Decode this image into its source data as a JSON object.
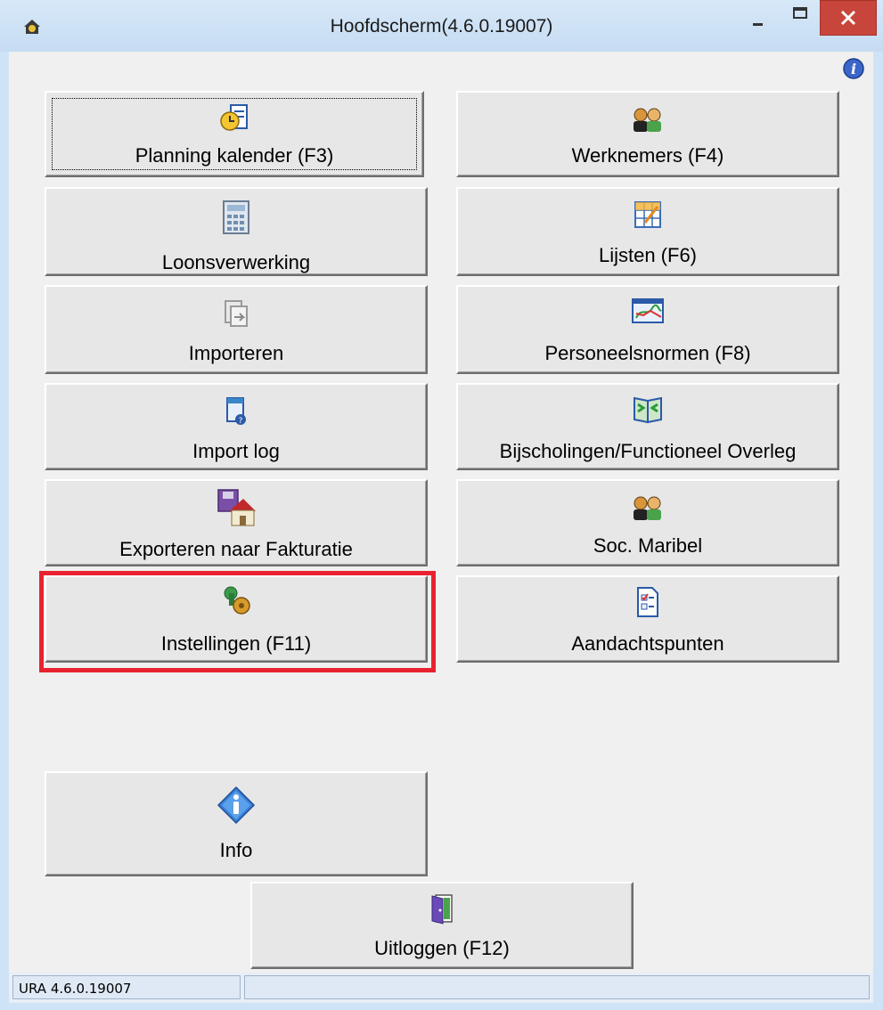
{
  "window": {
    "title": "Hoofdscherm(4.6.0.19007)",
    "close_symbol": "✕",
    "accent_close": "#c8453b"
  },
  "buttons": {
    "planning": "Planning kalender (F3)",
    "werknemers": "Werknemers (F4)",
    "loonsverwerking": "Loonsverwerking",
    "lijsten": "Lijsten (F6)",
    "importeren": "Importeren",
    "personeelsnormen": "Personeelsnormen (F8)",
    "import_log": "Import log",
    "bijscholingen": "Bijscholingen/Functioneel Overleg",
    "exporteren": "Exporteren naar Fakturatie",
    "soc_maribel": "Soc. Maribel",
    "instellingen": "Instellingen (F11)",
    "aandachtspunten": "Aandachtspunten",
    "info": "Info",
    "uitloggen": "Uitloggen (F12)"
  },
  "icons": {
    "planning": "calendar-clock-icon",
    "werknemers": "users-icon",
    "loonsverwerking": "calculator-icon",
    "lijsten": "spreadsheet-icon",
    "importeren": "import-icon",
    "personeelsnormen": "chart-icon",
    "import_log": "log-icon",
    "bijscholingen": "book-icon",
    "exporteren": "export-house-icon",
    "soc_maribel": "users-icon",
    "instellingen": "settings-icon",
    "aandachtspunten": "checklist-icon",
    "info": "info-icon",
    "uitloggen": "door-icon"
  },
  "status": {
    "version": "URA 4.6.0.19007"
  },
  "colors": {
    "highlight": "#e8232f"
  }
}
